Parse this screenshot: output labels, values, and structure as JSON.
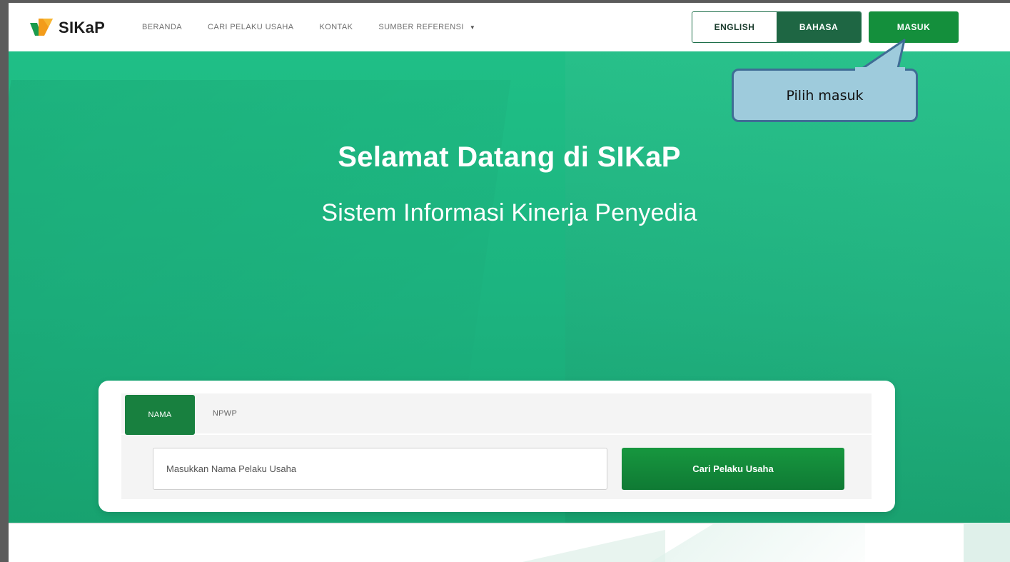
{
  "brand": {
    "name": "SIKaP"
  },
  "nav": {
    "items": [
      {
        "label": "BERANDA"
      },
      {
        "label": "CARI PELAKU USAHA"
      },
      {
        "label": "KONTAK"
      },
      {
        "label": "SUMBER REFERENSI"
      }
    ]
  },
  "language": {
    "english": "ENGLISH",
    "bahasa": "BAHASA"
  },
  "auth": {
    "login_label": "MASUK"
  },
  "tooltip": {
    "text": "Pilih masuk"
  },
  "hero": {
    "title": "Selamat Datang di SIKaP",
    "subtitle": "Sistem Informasi Kinerja Penyedia"
  },
  "search": {
    "tabs": [
      {
        "label": "NAMA"
      },
      {
        "label": "NPWP"
      }
    ],
    "active_tab": "NAMA",
    "placeholder": "Masukkan Nama Pelaku Usaha",
    "value": "",
    "button_label": "Cari Pelaku Usaha"
  },
  "colors": {
    "hero_green": "#1fbf86",
    "button_green": "#148f3c",
    "bahasa_green": "#1e6643",
    "tooltip_fill": "#9ecbdc",
    "tooltip_border": "#3f6c95"
  }
}
